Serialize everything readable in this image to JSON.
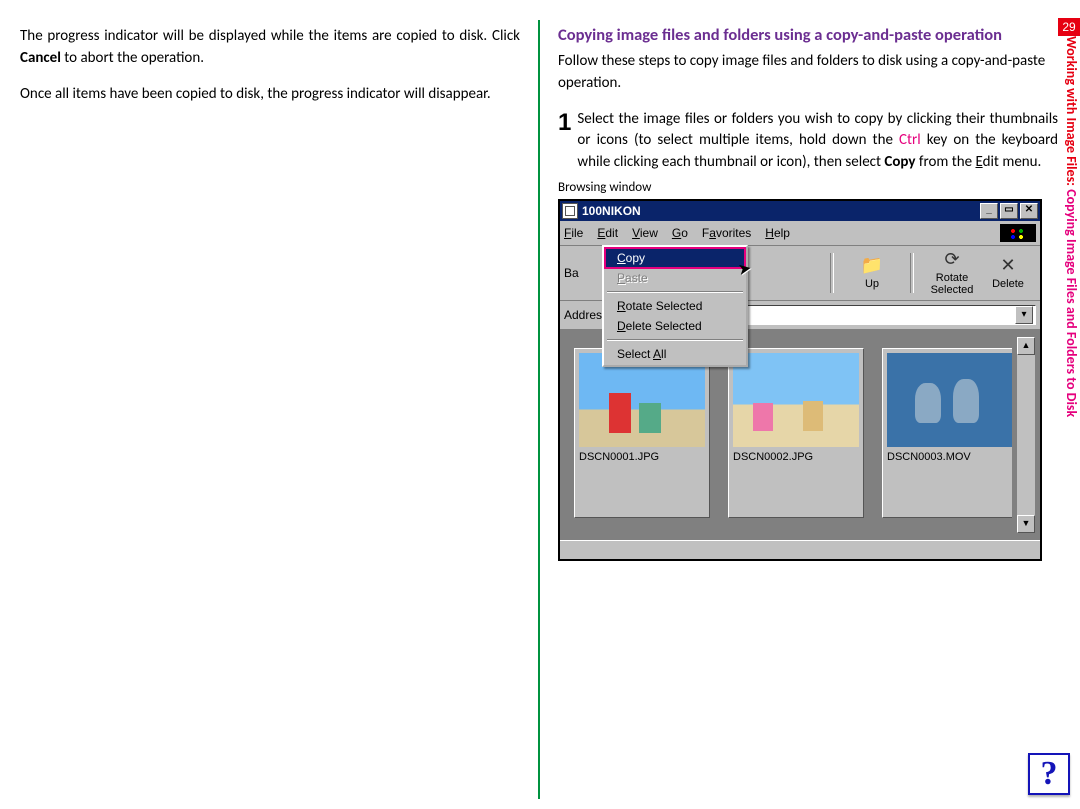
{
  "page_number": "29",
  "side_label_a": "Working with Image Files:",
  "side_label_b": " Copying Image Files and Folders to Disk",
  "col_left": {
    "p1_a": "The progress indicator will be displayed while the items are copied to disk.  Click ",
    "p1_bold": "Cancel",
    "p1_b": " to abort the operation.",
    "p2": "Once all items have been copied to disk, the progress indicator will disappear."
  },
  "col_right": {
    "heading": "Copying image files and folders using a copy-and-paste operation",
    "intro": "Follow these steps to copy image files and folders to disk using a copy-and-paste operation.",
    "step_num": "1",
    "step_a": "Select the image files or folders you wish to copy by clicking their thumbnails or icons (to select multiple items, hold down the ",
    "step_ctrl": "Ctrl",
    "step_b": " key on the keyboard while clicking each thumbnail or icon), then select ",
    "step_bold": "Copy",
    "step_c": " from the ",
    "step_u": "E",
    "step_d": "dit menu.",
    "caption": "Browsing window"
  },
  "window": {
    "title": "100NIKON",
    "min": "_",
    "max": "▭",
    "close": "✕",
    "menu": {
      "file": "File",
      "edit": "Edit",
      "view": "View",
      "go": "Go",
      "favorites": "Favorites",
      "help": "Help"
    },
    "edit_menu": {
      "copy": "Copy",
      "paste": "Paste",
      "rotate": "Rotate Selected",
      "delete": "Delete Selected",
      "select_all": "Select All"
    },
    "toolbar": {
      "back": "Ba",
      "up": "Up",
      "rotate": "Rotate Selected",
      "delete": "Delete"
    },
    "addrbar": {
      "label": "Addres"
    },
    "files": [
      "DSCN0001.JPG",
      "DSCN0002.JPG",
      "DSCN0003.MOV"
    ]
  },
  "help_glyph": "?"
}
